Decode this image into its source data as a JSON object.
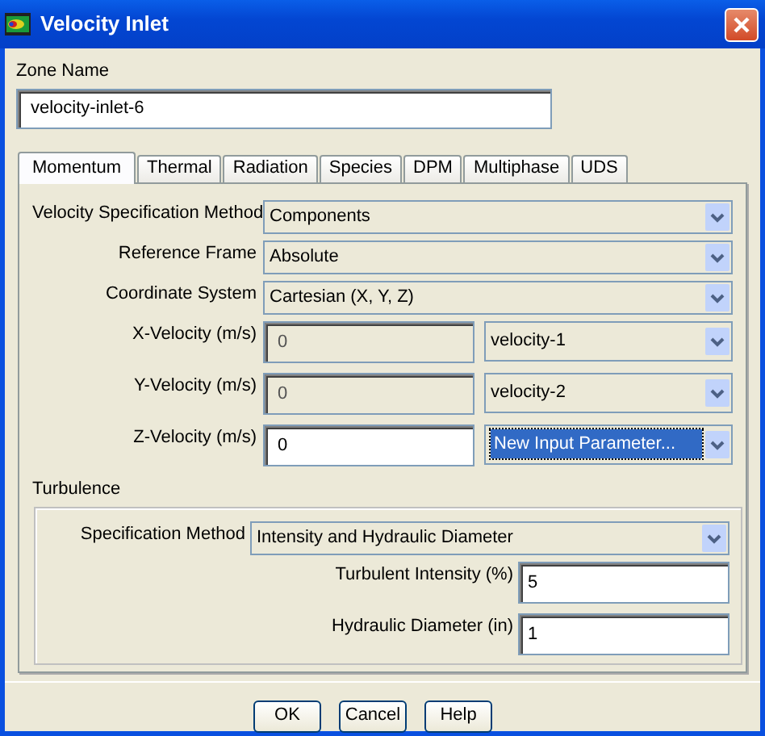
{
  "window": {
    "title": "Velocity Inlet"
  },
  "zone_name": {
    "label": "Zone Name",
    "value": "velocity-inlet-6"
  },
  "tabs": [
    {
      "label": "Momentum",
      "selected": true
    },
    {
      "label": "Thermal",
      "selected": false
    },
    {
      "label": "Radiation",
      "selected": false
    },
    {
      "label": "Species",
      "selected": false
    },
    {
      "label": "DPM",
      "selected": false
    },
    {
      "label": "Multiphase",
      "selected": false
    },
    {
      "label": "UDS",
      "selected": false
    }
  ],
  "momentum": {
    "selects": [
      {
        "label": "Velocity Specification Method",
        "value": "Components"
      },
      {
        "label": "Reference Frame",
        "value": "Absolute"
      },
      {
        "label": "Coordinate System",
        "value": "Cartesian (X, Y, Z)"
      }
    ],
    "velocities": [
      {
        "label": "X-Velocity (m/s)",
        "value": "0",
        "disabled": true,
        "parameter": "velocity-1",
        "focused": false
      },
      {
        "label": "Y-Velocity (m/s)",
        "value": "0",
        "disabled": true,
        "parameter": "velocity-2",
        "focused": false
      },
      {
        "label": "Z-Velocity (m/s)",
        "value": "0",
        "disabled": false,
        "parameter": "New Input Parameter...",
        "focused": true
      }
    ]
  },
  "turbulence": {
    "title": "Turbulence",
    "method": {
      "label": "Specification Method",
      "value": "Intensity and Hydraulic Diameter"
    },
    "fields": [
      {
        "label": "Turbulent Intensity (%)",
        "value": "5"
      },
      {
        "label": "Hydraulic Diameter (in)",
        "value": "1"
      }
    ]
  },
  "buttons": [
    "OK",
    "Cancel",
    "Help"
  ]
}
